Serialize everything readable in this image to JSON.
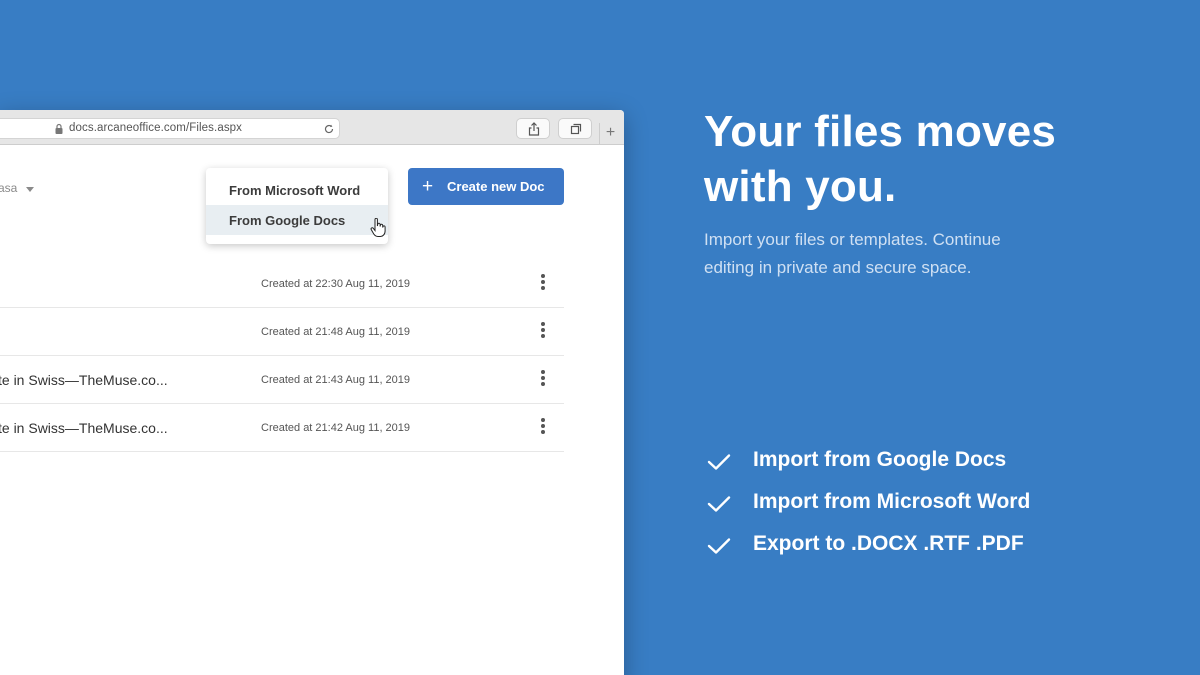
{
  "browser": {
    "url": "docs.arcaneoffice.com/Files.aspx",
    "new_tab_label": "+"
  },
  "app": {
    "owner_label": "asa",
    "create_button": {
      "icon": "+",
      "label": "Create new Doc"
    },
    "import_menu": {
      "items": [
        {
          "label": "From Microsoft Word"
        },
        {
          "label": "From Google Docs",
          "hovered": true
        }
      ]
    },
    "files": [
      {
        "name": "",
        "created": "Created at 22:30 Aug 11, 2019"
      },
      {
        "name": "",
        "created": "Created at 21:48 Aug 11, 2019"
      },
      {
        "name": "te in Swiss—TheMuse.co...",
        "created": "Created at 21:43 Aug 11, 2019"
      },
      {
        "name": "te in Swiss—TheMuse.co...",
        "created": "Created at 21:42 Aug 11, 2019"
      }
    ]
  },
  "promo": {
    "headline_line1": "Your files moves",
    "headline_line2": "with you.",
    "subtitle_line1": "Import your files or templates. Continue",
    "subtitle_line2": "editing in private and secure space.",
    "features": [
      {
        "icon": "check-icon",
        "text": "Import from Google Docs"
      },
      {
        "icon": "check-icon",
        "text": "Import from Microsoft Word"
      },
      {
        "icon": "check-icon",
        "text": "Export to .DOCX  .RTF  .PDF"
      }
    ]
  },
  "colors": {
    "background": "#387dc4",
    "primary_button": "#3d77c6",
    "menu_hover": "#e8eef2"
  }
}
